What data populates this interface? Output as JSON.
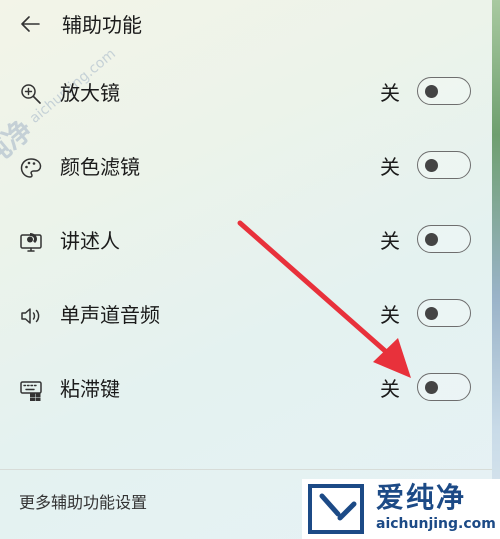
{
  "header": {
    "title": "辅助功能",
    "back_icon": "back-arrow-icon"
  },
  "settings": [
    {
      "label": "放大镜",
      "icon": "magnifier-icon",
      "state": "关",
      "on": false
    },
    {
      "label": "颜色滤镜",
      "icon": "color-filter-icon",
      "state": "关",
      "on": false
    },
    {
      "label": "讲述人",
      "icon": "narrator-icon",
      "state": "关",
      "on": false
    },
    {
      "label": "单声道音频",
      "icon": "mono-audio-icon",
      "state": "关",
      "on": false
    },
    {
      "label": "粘滞键",
      "icon": "sticky-keys-icon",
      "state": "关",
      "on": false
    }
  ],
  "footer": {
    "link_label": "更多辅助功能设置"
  },
  "watermark": {
    "brand": "爱纯净",
    "url": "aichunjing.com",
    "diagonal_brand": "爱纯净",
    "diagonal_url": "aichunjing.com"
  },
  "colors": {
    "accent": "#e8313b",
    "watermark_blue": "#1c4a86",
    "toggle_border": "#6e6e6e",
    "toggle_knob": "#444444"
  }
}
